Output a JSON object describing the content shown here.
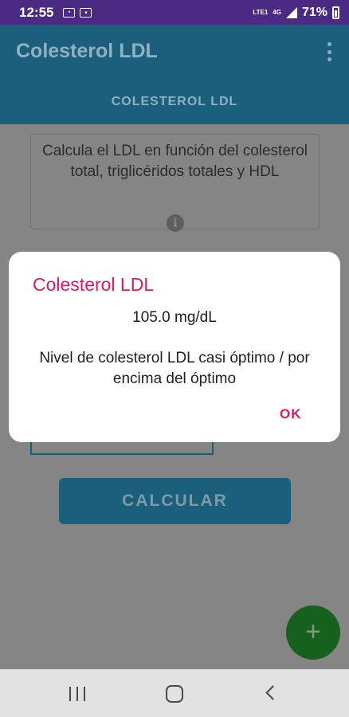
{
  "status_bar": {
    "time": "12:55",
    "battery": "71%",
    "network": "4G",
    "lte": "LTE1"
  },
  "app_bar": {
    "title": "Colesterol LDL",
    "tab": "COLESTEROL LDL"
  },
  "content": {
    "description": "Calcula el LDL en función del colesterol total, triglicéridos totales y HDL",
    "info_icon": "i",
    "calculate_label": "CALCULAR",
    "fab_label": "+"
  },
  "dialog": {
    "title": "Colesterol LDL",
    "value": "105.0 mg/dL",
    "message": "Nivel de colesterol LDL casi óptimo / por encima del óptimo",
    "ok_label": "OK"
  },
  "icons": {
    "menu": "more-vert-icon",
    "info": "info-icon",
    "add": "add-icon",
    "recents": "recents-icon",
    "home": "home-icon",
    "back": "back-icon"
  },
  "colors": {
    "status_bar": "#4a2a82",
    "accent": "#d81b60",
    "primary": "#1c5f7d",
    "fab": "#17611f"
  }
}
